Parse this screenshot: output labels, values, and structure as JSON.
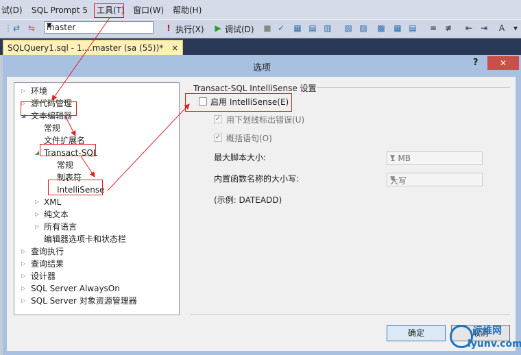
{
  "menubar": {
    "items": [
      "试(D)",
      "SQL Prompt 5",
      "工具(T)",
      "窗口(W)",
      "帮助(H)"
    ]
  },
  "toolbar": {
    "database": "master",
    "execute": "执行(X)",
    "debug": "调试(D)"
  },
  "tab": {
    "title": "SQLQuery1.sql - 1....master (sa (55))*",
    "close": "×"
  },
  "dialog": {
    "title": "选项",
    "help": "?",
    "close": "✕"
  },
  "tree": {
    "nodes": [
      "环境",
      "源代码管理",
      "文本编辑器",
      "常规",
      "文件扩展名",
      "Transact-SQL",
      "常规",
      "制表符",
      "IntelliSense",
      "XML",
      "纯文本",
      "所有语言",
      "编辑器选项卡和状态栏",
      "查询执行",
      "查询结果",
      "设计器",
      "SQL Server AlwaysOn",
      "SQL Server 对象资源管理器"
    ]
  },
  "panel": {
    "group_title": "Transact-SQL IntelliSense 设置",
    "enable": "启用 IntelliSense(E)",
    "underline": "用下划线标出错误(U)",
    "outline": "概括语句(O)",
    "max_script_label": "最大脚本大小:",
    "max_script_value": "1 MB",
    "case_label": "内置函数名称的大小写:",
    "case_value": "大写",
    "example": "(示例: DATEADD)"
  },
  "buttons": {
    "ok": "确定",
    "cancel": "取消"
  },
  "watermark": {
    "line1": "运维网",
    "line2": "iyunv.com"
  },
  "colors": {
    "annotation": "#e02020",
    "tab_active": "#fff1b8",
    "close_button": "#c7504a"
  }
}
